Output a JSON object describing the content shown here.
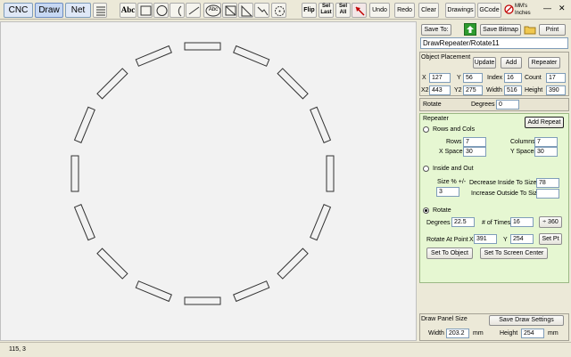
{
  "toolbar": {
    "tabs": [
      "CNC",
      "Draw",
      "Net"
    ],
    "abc_label": "Abc",
    "abc_circle_label": "Abc",
    "flip_label": "Flip",
    "sel_last_label": "Sel\nLast",
    "sel_all_label": "Sel\nAll",
    "undo_label": "Undo",
    "redo_label": "Redo",
    "clear_label": "Clear",
    "drawings_label": "Drawings",
    "gcode_label": "GCode",
    "units_line1": "MM's",
    "units_line2": "Inches",
    "minimize": "—",
    "close": "✕"
  },
  "panel": {
    "save_to_label": "Save To:",
    "save_bitmap_label": "Save Bitmap",
    "print_label": "Print",
    "file_name": "DrawRepeater/Rotate11",
    "object_placement": {
      "title": "Object Placement",
      "update_label": "Update",
      "add_label": "Add",
      "repeater_label": "Repeater",
      "x_label": "X",
      "x_value": "127",
      "y_label": "Y",
      "y_value": "56",
      "index_label": "Index",
      "index_value": "16",
      "count_label": "Count",
      "count_value": "17",
      "x2_label": "X2",
      "x2_value": "443",
      "y2_label": "Y2",
      "y2_value": "275",
      "width_label": "Width",
      "width_value": "516",
      "height_label": "Height",
      "height_value": "390"
    },
    "rotate": {
      "title": "Rotate",
      "degrees_label": "Degrees",
      "degrees_value": "0"
    },
    "repeater": {
      "title": "Repeater",
      "add_repeat_label": "Add Repeat",
      "rows_cols_label": "Rows and Cols",
      "rows_label": "Rows",
      "rows_value": "7",
      "columns_label": "Columns",
      "columns_value": "7",
      "x_spacer_label": "X Spacer",
      "x_spacer_value": "30",
      "y_spacer_label": "Y Spacer",
      "y_spacer_value": "30",
      "inside_out_label": "Inside and Out",
      "size_label": "Size % +/-",
      "size_value": "3",
      "decrease_label": "Decrease Inside To Size %",
      "decrease_value": "78",
      "increase_label": "Increase Outside To Size %",
      "increase_value": "",
      "rotate_label": "Rotate",
      "degrees_label": "Degrees",
      "degrees_value": "22.5",
      "times_label": "# of Times",
      "times_value": "16",
      "plus360_label": "÷ 360",
      "rotate_point_label": "Rotate At Point",
      "rp_x_label": "X",
      "rp_x_value": "391",
      "rp_y_label": "Y",
      "rp_y_value": "254",
      "set_pt_label": "Set Pt",
      "set_to_object_label": "Set To Object",
      "set_to_center_label": "Set To Screen Center"
    },
    "draw_panel": {
      "title": "Draw Panel Size",
      "save_settings_label": "Save Draw Settings",
      "width_label": "Width",
      "width_value": "203.2",
      "width_unit": "mm",
      "height_label": "Height",
      "height_value": "254",
      "height_unit": "mm"
    }
  },
  "status": {
    "coords": "115, 3"
  },
  "colors": {
    "repeater_bg": "#e6f7d2",
    "accent_green": "#2e9b2e",
    "red_icon": "#c00000"
  }
}
